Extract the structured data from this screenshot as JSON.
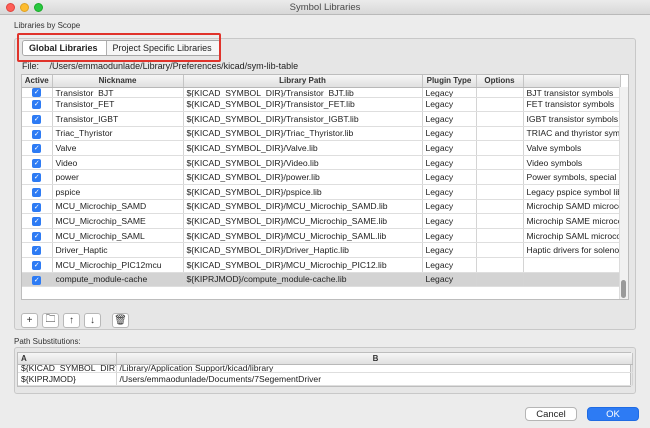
{
  "window": {
    "title": "Symbol Libraries"
  },
  "libraries_section": {
    "label": "Libraries by Scope"
  },
  "tabs": [
    {
      "label": "Global Libraries",
      "active": true
    },
    {
      "label": "Project Specific Libraries",
      "active": false
    }
  ],
  "file": {
    "label": "File:",
    "path": "/Users/emmaodunlade/Library/Preferences/kicad/sym-lib-table"
  },
  "table": {
    "columns": [
      "Active",
      "Nickname",
      "Library Path",
      "Plugin Type",
      "Options",
      ""
    ],
    "rows": [
      {
        "active": true,
        "nickname": "Transistor_BJT",
        "path": "${KICAD_SYMBOL_DIR}/Transistor_BJT.lib",
        "plugin": "Legacy",
        "options": "",
        "description": "BJT transistor symbols"
      },
      {
        "active": true,
        "nickname": "Transistor_FET",
        "path": "${KICAD_SYMBOL_DIR}/Transistor_FET.lib",
        "plugin": "Legacy",
        "options": "",
        "description": "FET transistor symbols"
      },
      {
        "active": true,
        "nickname": "Transistor_IGBT",
        "path": "${KICAD_SYMBOL_DIR}/Transistor_IGBT.lib",
        "plugin": "Legacy",
        "options": "",
        "description": "IGBT transistor symbols"
      },
      {
        "active": true,
        "nickname": "Triac_Thyristor",
        "path": "${KICAD_SYMBOL_DIR}/Triac_Thyristor.lib",
        "plugin": "Legacy",
        "options": "",
        "description": "TRIAC and thyristor symb"
      },
      {
        "active": true,
        "nickname": "Valve",
        "path": "${KICAD_SYMBOL_DIR}/Valve.lib",
        "plugin": "Legacy",
        "options": "",
        "description": "Valve symbols"
      },
      {
        "active": true,
        "nickname": "Video",
        "path": "${KICAD_SYMBOL_DIR}/Video.lib",
        "plugin": "Legacy",
        "options": "",
        "description": "Video symbols"
      },
      {
        "active": true,
        "nickname": "power",
        "path": "${KICAD_SYMBOL_DIR}/power.lib",
        "plugin": "Legacy",
        "options": "",
        "description": "Power symbols, special p"
      },
      {
        "active": true,
        "nickname": "pspice",
        "path": "${KICAD_SYMBOL_DIR}/pspice.lib",
        "plugin": "Legacy",
        "options": "",
        "description": "Legacy pspice symbol lib"
      },
      {
        "active": true,
        "nickname": "MCU_Microchip_SAMD",
        "path": "${KICAD_SYMBOL_DIR}/MCU_Microchip_SAMD.lib",
        "plugin": "Legacy",
        "options": "",
        "description": "Microchip SAMD microco"
      },
      {
        "active": true,
        "nickname": "MCU_Microchip_SAME",
        "path": "${KICAD_SYMBOL_DIR}/MCU_Microchip_SAME.lib",
        "plugin": "Legacy",
        "options": "",
        "description": "Microchip SAME microco"
      },
      {
        "active": true,
        "nickname": "MCU_Microchip_SAML",
        "path": "${KICAD_SYMBOL_DIR}/MCU_Microchip_SAML.lib",
        "plugin": "Legacy",
        "options": "",
        "description": "Microchip SAML microco"
      },
      {
        "active": true,
        "nickname": "Driver_Haptic",
        "path": "${KICAD_SYMBOL_DIR}/Driver_Haptic.lib",
        "plugin": "Legacy",
        "options": "",
        "description": "Haptic drivers for soleno"
      },
      {
        "active": true,
        "nickname": "MCU_Microchip_PIC12mcu",
        "path": "${KICAD_SYMBOL_DIR}/MCU_Microchip_PIC12.lib",
        "plugin": "Legacy",
        "options": "",
        "description": ""
      },
      {
        "active": true,
        "nickname": "compute_module-cache",
        "path": "${KIPRJMOD}/compute_module-cache.lib",
        "plugin": "Legacy",
        "options": "",
        "description": "",
        "selected": true
      }
    ]
  },
  "toolbar": {
    "icons": [
      "add-icon",
      "folder-icon",
      "move-up-icon",
      "move-down-icon",
      "delete-icon"
    ],
    "glyphs": [
      "+",
      "🗀",
      "↑",
      "↓",
      "🗑"
    ]
  },
  "substitutions": {
    "label": "Path Substitutions:",
    "columns": [
      "A",
      "B"
    ],
    "rows": [
      {
        "name": "${KICAD_SYMBOL_DIR}",
        "value": "/Library/Application Support/kicad/library"
      },
      {
        "name": "${KIPRJMOD}",
        "value": "/Users/emmaodunlade/Documents/7SegementDriver"
      }
    ]
  },
  "buttons": {
    "cancel": "Cancel",
    "ok": "OK"
  },
  "colors": {
    "accent": "#2d7bf4",
    "highlight_box": "#e0332b"
  }
}
